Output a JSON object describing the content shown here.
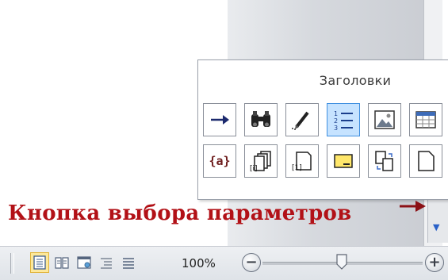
{
  "popup": {
    "title": "Заголовки",
    "field_code_label": "{a}"
  },
  "caption": {
    "text": "Кнопка выбора параметров",
    "color": "#b21117"
  },
  "statusbar": {
    "zoom_label": "100%",
    "zoom_out_label": "−",
    "zoom_in_label": "+",
    "zoom_level_fraction": 0.5,
    "active_view": "print-layout"
  },
  "scroll": {
    "circle_glyph": "○",
    "arrow_glyph": "▼"
  },
  "colors": {
    "accent_active": "#c6e3ff",
    "view_active": "#fde89a"
  }
}
